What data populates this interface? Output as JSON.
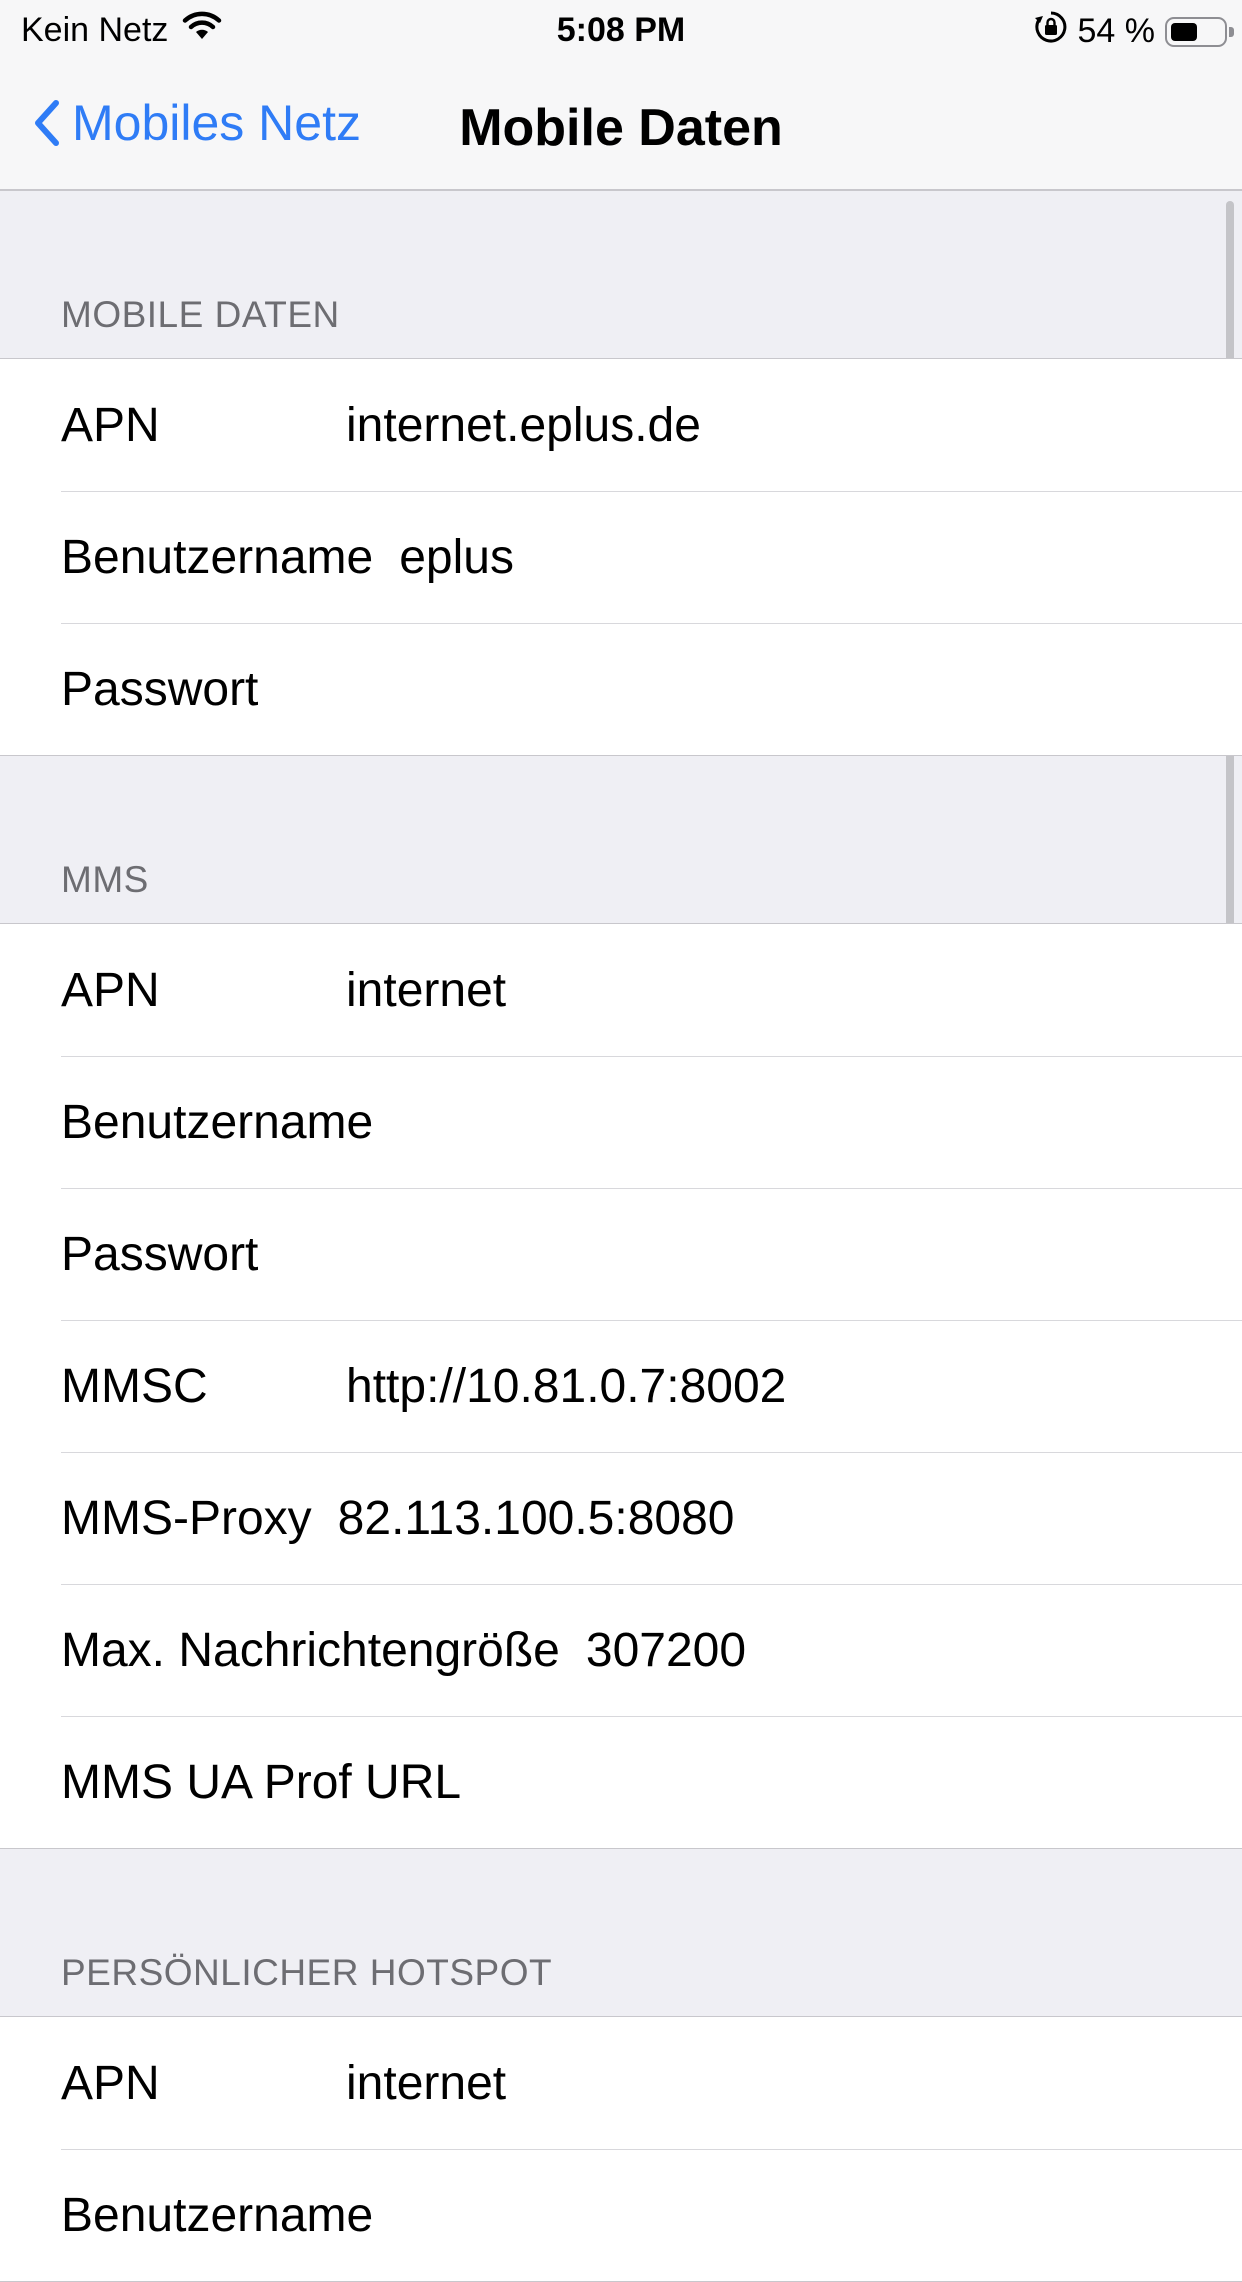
{
  "status_bar": {
    "carrier": "Kein Netz",
    "time": "5:08 PM",
    "battery_text": "54 %",
    "battery_level": 0.54
  },
  "nav": {
    "back_label": "Mobiles Netz",
    "title": "Mobile Daten"
  },
  "sections": {
    "mobile_data": {
      "header": "MOBILE DATEN",
      "apn_label": "APN",
      "apn_value": "internet.eplus.de",
      "username_label": "Benutzername",
      "username_value": "eplus",
      "password_label": "Passwort",
      "password_value": ""
    },
    "mms": {
      "header": "MMS",
      "apn_label": "APN",
      "apn_value": "internet",
      "username_label": "Benutzername",
      "username_value": "",
      "password_label": "Passwort",
      "password_value": "",
      "mmsc_label": "MMSC",
      "mmsc_value": "http://10.81.0.7:8002",
      "proxy_label": "MMS-Proxy",
      "proxy_value": "82.113.100.5:8080",
      "max_size_label": "Max. Nachrichtengröße",
      "max_size_value": "307200",
      "ua_prof_label": "MMS UA Prof URL",
      "ua_prof_value": ""
    },
    "hotspot": {
      "header": "PERSÖNLICHER HOTSPOT",
      "apn_label": "APN",
      "apn_value": "internet",
      "username_label": "Benutzername"
    }
  },
  "colors": {
    "accent": "#2f7cf6",
    "background": "#efeff4",
    "header_text": "#6d6d72"
  }
}
